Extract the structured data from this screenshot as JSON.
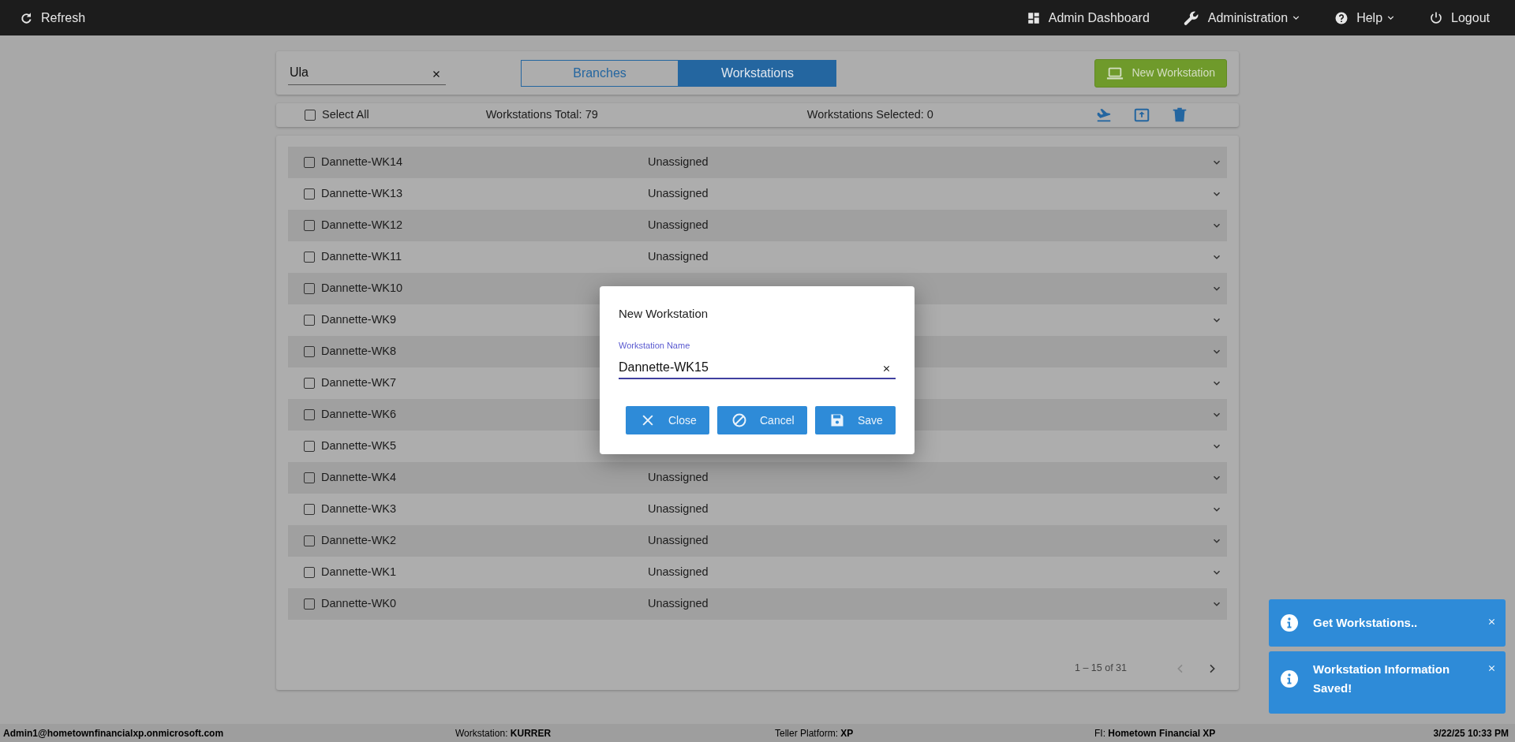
{
  "topbar": {
    "refresh": "Refresh",
    "menu": [
      {
        "kind": "dashboard",
        "label": "Admin Dashboard",
        "dropdown": false
      },
      {
        "kind": "wrench",
        "label": "Administration",
        "dropdown": true
      },
      {
        "kind": "help",
        "label": "Help",
        "dropdown": true
      },
      {
        "kind": "power",
        "label": "Logout",
        "dropdown": false
      }
    ]
  },
  "search": {
    "value": "Ula"
  },
  "tabs": [
    {
      "label": "Branches",
      "selected": false
    },
    {
      "label": "Workstations",
      "selected": true
    }
  ],
  "new_button": "New Workstation",
  "toolbar": {
    "select_all": {
      "label": "Select All",
      "checked": false
    },
    "total": "Workstations Total: 79",
    "selected_count": "Workstations Selected: 0"
  },
  "rows": [
    {
      "name": "Dannette-WK14",
      "status": "Unassigned",
      "checked": false
    },
    {
      "name": "Dannette-WK13",
      "status": "Unassigned",
      "checked": false
    },
    {
      "name": "Dannette-WK12",
      "status": "Unassigned",
      "checked": false
    },
    {
      "name": "Dannette-WK11",
      "status": "Unassigned",
      "checked": false
    },
    {
      "name": "Dannette-WK10",
      "checked": false
    },
    {
      "name": "Dannette-WK9",
      "checked": false
    },
    {
      "name": "Dannette-WK8",
      "checked": false
    },
    {
      "name": "Dannette-WK7",
      "checked": false
    },
    {
      "name": "Dannette-WK6",
      "checked": false
    },
    {
      "name": "Dannette-WK5",
      "checked": false
    },
    {
      "name": "Dannette-WK4",
      "status": "Unassigned",
      "checked": false
    },
    {
      "name": "Dannette-WK3",
      "status": "Unassigned",
      "checked": false
    },
    {
      "name": "Dannette-WK2",
      "status": "Unassigned",
      "checked": false
    },
    {
      "name": "Dannette-WK1",
      "status": "Unassigned",
      "checked": false
    },
    {
      "name": "Dannette-WK0",
      "status": "Unassigned",
      "checked": false
    }
  ],
  "pagination": {
    "range": "1 – 15 of 31",
    "prev_disabled": true,
    "next_disabled": false
  },
  "dialog": {
    "title": "New Workstation",
    "field_label": "Workstation Name",
    "field_value": "Dannette-WK15",
    "buttons": [
      {
        "kind": "close",
        "label": "Close"
      },
      {
        "kind": "cancel",
        "label": "Cancel"
      },
      {
        "kind": "save",
        "label": "Save"
      }
    ]
  },
  "toasts": [
    "Get Workstations..",
    "Workstation Information Saved!"
  ],
  "status_bar": [
    {
      "value": "Admin1@hometownfinancialxp.onmicrosoft.com"
    },
    {
      "label": "Workstation:",
      "value": "KURRER"
    },
    {
      "label": "Teller Platform:",
      "value": "XP"
    },
    {
      "label": "FI:",
      "value": "Hometown Financial XP"
    },
    {
      "value": "3/22/25 10:33 PM"
    }
  ]
}
